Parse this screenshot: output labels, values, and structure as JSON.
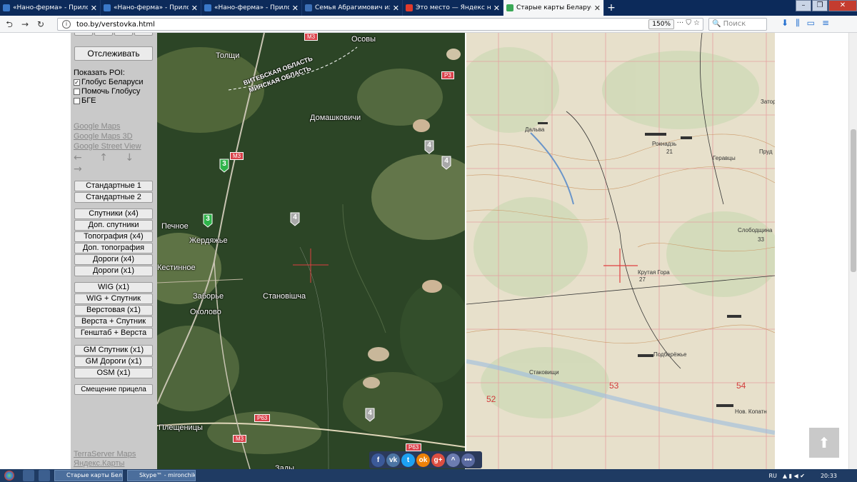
{
  "browser": {
    "tabs": [
      {
        "title": "«Нано-ферма» - Приложения",
        "color": "#3a78c8",
        "active": false
      },
      {
        "title": "«Нано-ферма» - Приложения",
        "color": "#3a78c8",
        "active": false
      },
      {
        "title": "«Нано-ферма» - Приложения",
        "color": "#3a78c8",
        "active": false
      },
      {
        "title": "Семья Абрагимович из д. Кру",
        "color": "#3c6fb5",
        "active": false
      },
      {
        "title": "Это место — Яндекс нашлось",
        "color": "#e03a2c",
        "active": false
      },
      {
        "title": "Старые карты Беларуси - вер",
        "color": "#3aa856",
        "active": true
      }
    ],
    "new_tab": "+",
    "url": "too.by/verstovka.html",
    "zoom": "150%",
    "search_placeholder": "Поиск",
    "url_icons": "···  ⛉  ☆"
  },
  "sidebar": {
    "track_button": "Отслеживать",
    "poi_label": "Показать POI:",
    "poi_options": [
      {
        "label": "Глобус Беларуси",
        "checked": true,
        "mark": "✓"
      },
      {
        "label": "Помочь Глобусу",
        "checked": false,
        "mark": ""
      },
      {
        "label": "БГЕ",
        "checked": false,
        "mark": ""
      }
    ],
    "google_links": [
      "Google Maps",
      "Google Maps 3D",
      "Google Street View"
    ],
    "arrows": "← ↑ ↓ →",
    "group1": [
      "Стандартные 1",
      "Стандартные 2"
    ],
    "group2": [
      "Спутники (x4)",
      "Доп. спутники",
      "Топография (x4)",
      "Доп. топография",
      "Дороги (x4)",
      "Дороги (x1)"
    ],
    "group3": [
      "WIG (x1)",
      "WIG + Спутник",
      "Верстовая (x1)",
      "Верста + Спутник",
      "Генштаб + Верста"
    ],
    "group4": [
      "GM Спутник (x1)",
      "GM Дороги (x1)",
      "OSM (x1)"
    ],
    "offset_button": "Смещение прицела",
    "bottom_links": [
      "TerraServer Maps",
      "Яндекс.Карты"
    ]
  },
  "satmap": {
    "labels": [
      {
        "text": "Толщи"
      },
      {
        "text": "Осовы"
      },
      {
        "text": "Домашковичи"
      },
      {
        "text": "Печное"
      },
      {
        "text": "Жердяжье"
      },
      {
        "text": "Кестинное"
      },
      {
        "text": "Заборье"
      },
      {
        "text": "Становішча"
      },
      {
        "text": "Околово"
      },
      {
        "text": "Плещеницы"
      },
      {
        "text": "Зады"
      }
    ],
    "region_top": "ВИТЕБСКАЯ ОБЛАСТЬ",
    "region_bottom": "МИНСКАЯ ОБЛАСТЬ",
    "road_signs": [
      "M3",
      "P3",
      "M3",
      "P63",
      "M3",
      "P63"
    ],
    "markers": [
      {
        "label": "3",
        "color": "#2fb34a"
      },
      {
        "label": "3",
        "color": "#2fb34a"
      },
      {
        "label": "4",
        "color": "#a8a8a8"
      },
      {
        "label": "4",
        "color": "#a8a8a8"
      },
      {
        "label": "4",
        "color": "#a8a8a8"
      },
      {
        "label": "4",
        "color": "#a8a8a8"
      }
    ]
  },
  "topomap": {
    "labels": [
      "Дальва",
      "Рокнадзь",
      "Геравцы",
      "Затор",
      "Слободщина",
      "Крутая Гора",
      "Подберёжье",
      "Стаковищи",
      "Нов. Копатн",
      "Пруд"
    ],
    "numbers": [
      "21",
      "27",
      "53",
      "52",
      "54",
      "33"
    ]
  },
  "social": {
    "buttons": [
      {
        "glyph": "f",
        "color": "#3b5998"
      },
      {
        "glyph": "vk",
        "color": "#4c75a3"
      },
      {
        "glyph": "t",
        "color": "#1da1f2"
      },
      {
        "glyph": "ok",
        "color": "#ee8208"
      },
      {
        "glyph": "g+",
        "color": "#dc4e41"
      },
      {
        "glyph": "^",
        "color": "#6c7cb0"
      },
      {
        "glyph": "•••",
        "color": "#5a6aa0"
      }
    ]
  },
  "scroll_top": "⬆",
  "taskbar": {
    "tasks": [
      "Старые карты Бела...",
      "Skype™ - mironchikt..."
    ],
    "lang": "RU",
    "time": "20:33"
  }
}
